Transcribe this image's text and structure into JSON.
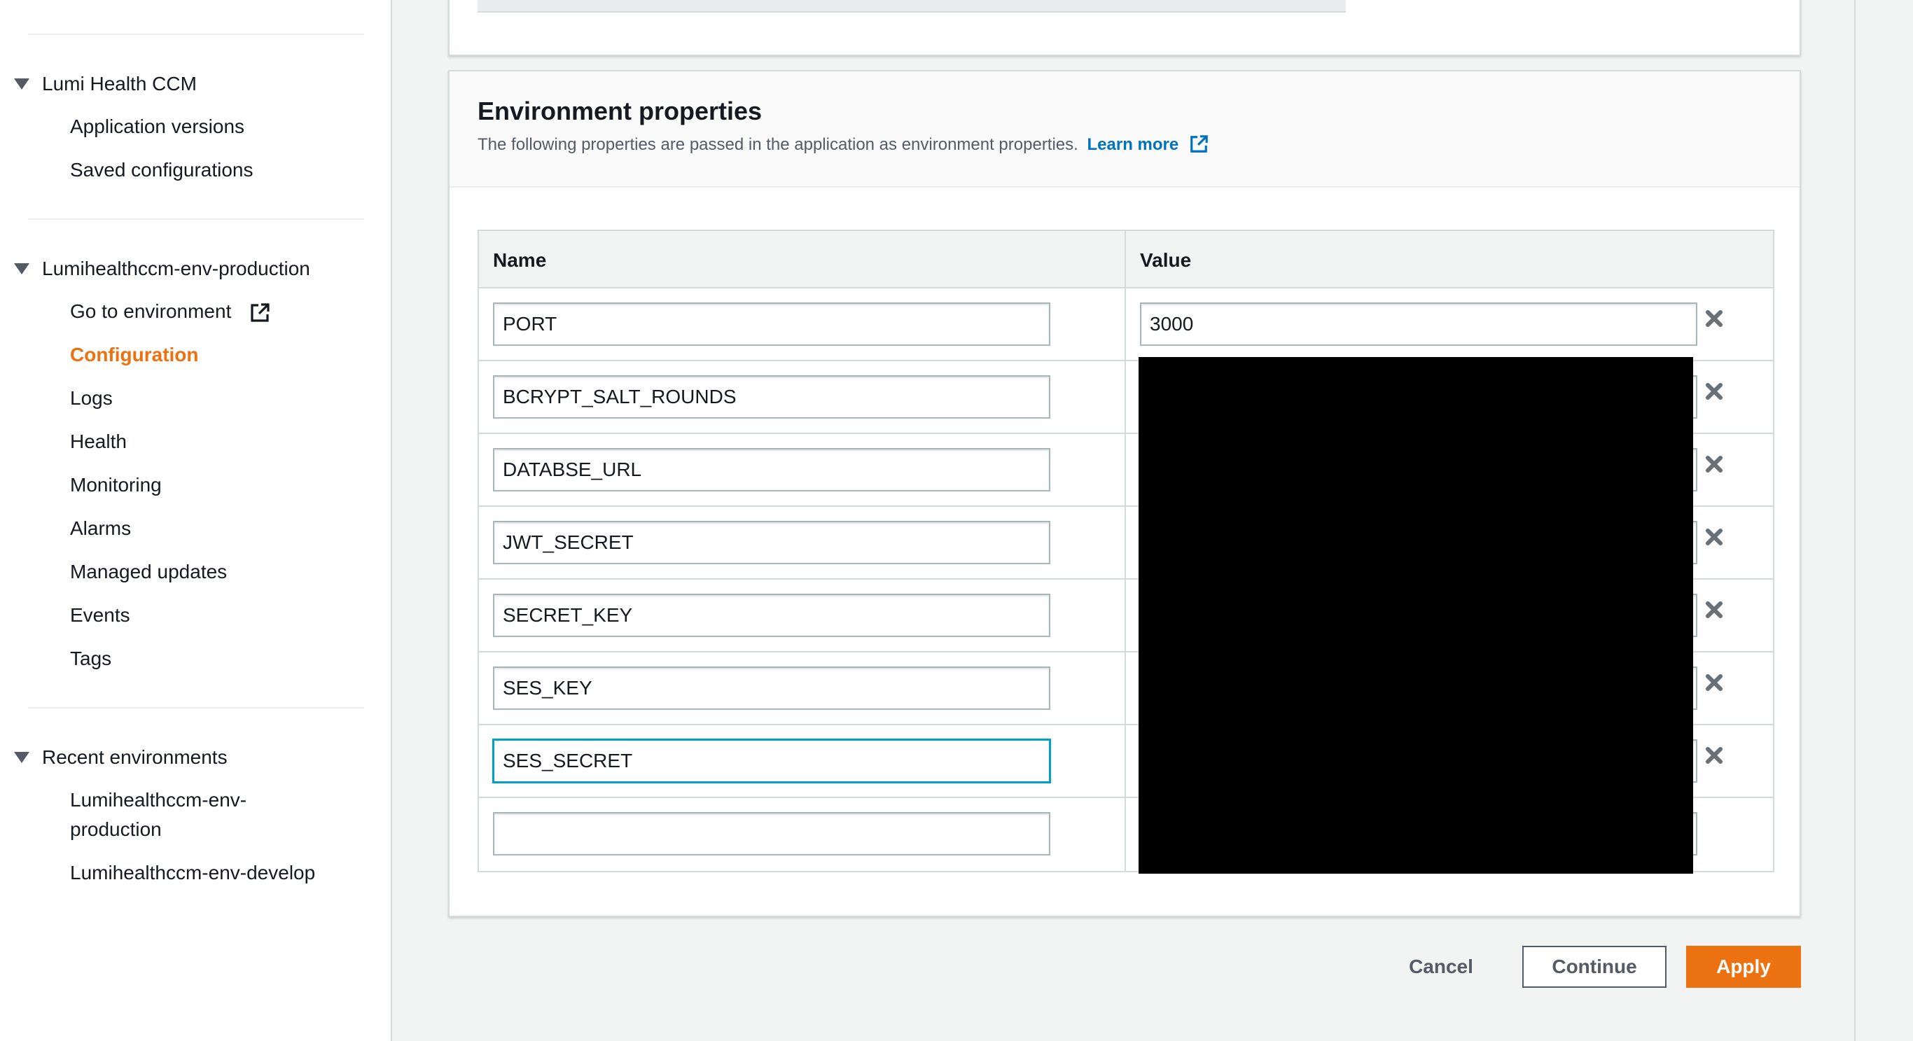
{
  "sidebar": {
    "app_section": {
      "title": "Lumi Health CCM",
      "items": [
        "Application versions",
        "Saved configurations"
      ]
    },
    "env_section": {
      "title": "Lumihealthccm-env-production",
      "items": [
        {
          "label": "Go to environment",
          "external": true
        },
        {
          "label": "Configuration",
          "active": true
        },
        {
          "label": "Logs"
        },
        {
          "label": "Health"
        },
        {
          "label": "Monitoring"
        },
        {
          "label": "Alarms"
        },
        {
          "label": "Managed updates"
        },
        {
          "label": "Events"
        },
        {
          "label": "Tags"
        }
      ]
    },
    "recent_section": {
      "title": "Recent environments",
      "items": [
        "Lumihealthccm-env-production",
        "Lumihealthccm-env-develop"
      ]
    }
  },
  "panel": {
    "title": "Environment properties",
    "description": "The following properties are passed in the application as environment properties.",
    "learn_more": "Learn more",
    "table": {
      "headers": {
        "name": "Name",
        "value": "Value"
      },
      "rows": [
        {
          "name": "PORT",
          "value": "3000"
        },
        {
          "name": "BCRYPT_SALT_ROUNDS",
          "value": ""
        },
        {
          "name": "DATABSE_URL",
          "value": ""
        },
        {
          "name": "JWT_SECRET",
          "value": ""
        },
        {
          "name": "SECRET_KEY",
          "value": ""
        },
        {
          "name": "SES_KEY",
          "value": ""
        },
        {
          "name": "SES_SECRET",
          "value": ""
        },
        {
          "name": "",
          "value": ""
        }
      ]
    }
  },
  "footer": {
    "cancel": "Cancel",
    "continue": "Continue",
    "apply": "Apply"
  },
  "colors": {
    "accent": "#ec7211",
    "link": "#0073bb",
    "focus": "#00a1c9"
  }
}
